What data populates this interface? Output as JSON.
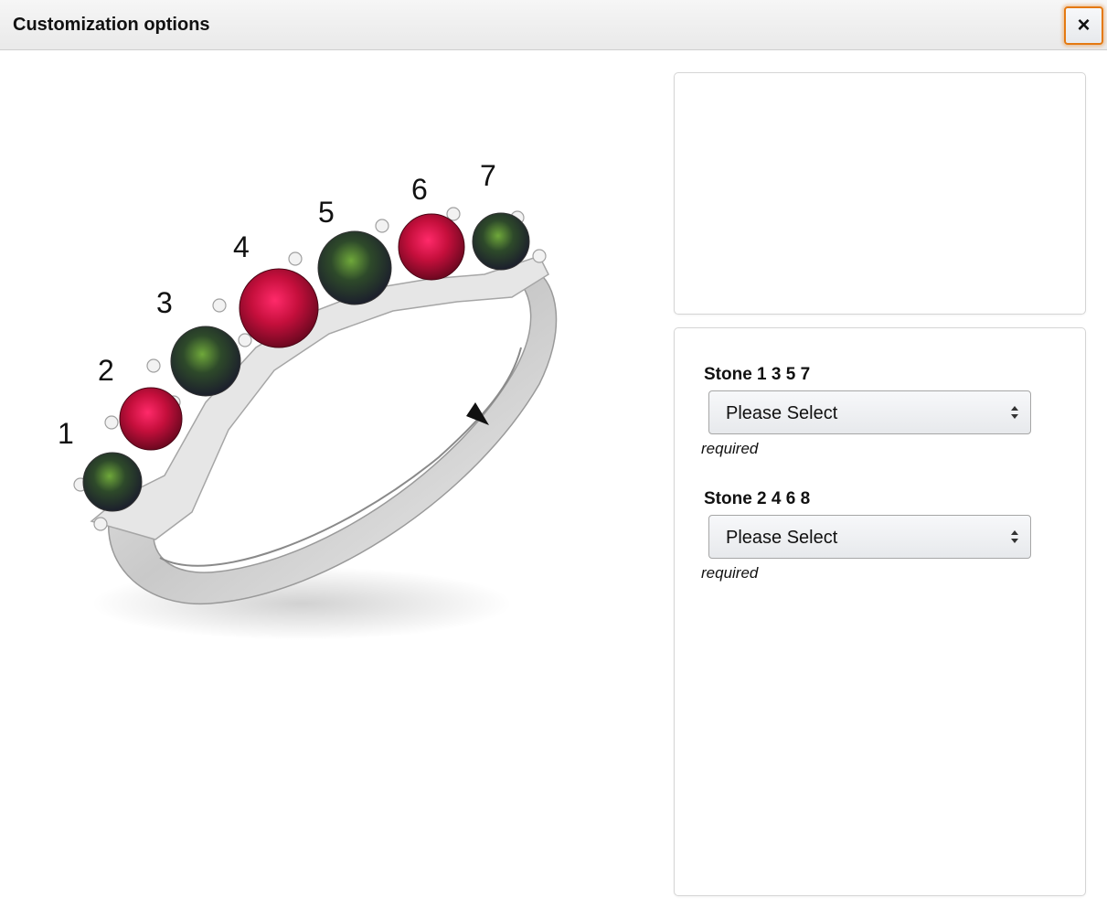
{
  "header": {
    "title": "Customization options",
    "close_label": "×"
  },
  "ring": {
    "stone_numbers": [
      "1",
      "2",
      "3",
      "4",
      "5",
      "6",
      "7"
    ]
  },
  "options": {
    "fields": [
      {
        "label": "Stone 1 3 5 7",
        "value": "Please Select",
        "hint": "required"
      },
      {
        "label": "Stone 2 4 6 8",
        "value": "Please Select",
        "hint": "required"
      }
    ]
  },
  "colors": {
    "mystic": "#2f3c2a",
    "ruby": "#b0103a",
    "silver": "#d9d9d9",
    "accent": "#e47911"
  }
}
